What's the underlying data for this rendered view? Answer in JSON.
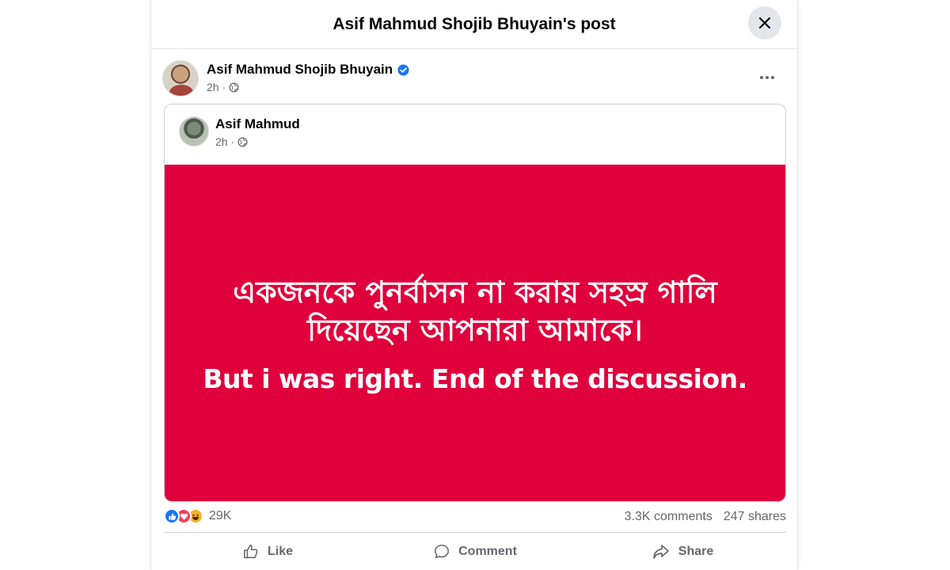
{
  "dialog": {
    "title": "Asif Mahmud Shojib Bhuyain's post",
    "close_icon": "close-icon"
  },
  "post": {
    "author": "Asif Mahmud Shojib Bhuyain",
    "verified": true,
    "time": "2h",
    "privacy_icon": "globe-icon",
    "shared": {
      "author": "Asif Mahmud",
      "time": "2h",
      "image_text_bangla": "একজনকে পুনর্বাসন না করায় সহস্র গালি দিয়েছেন আপনারা আমাকে।",
      "image_text_english": "But i was right. End of the discussion.",
      "image_bg": "#e0003c"
    },
    "reactions": {
      "types": [
        "like",
        "love",
        "haha"
      ],
      "count": "29K"
    },
    "comments": "3.3K comments",
    "shares": "247 shares"
  },
  "actions": {
    "like": "Like",
    "comment": "Comment",
    "share": "Share"
  },
  "colors": {
    "accent": "#1877f2",
    "secondary_text": "#65676b",
    "divider": "#ced0d4"
  }
}
